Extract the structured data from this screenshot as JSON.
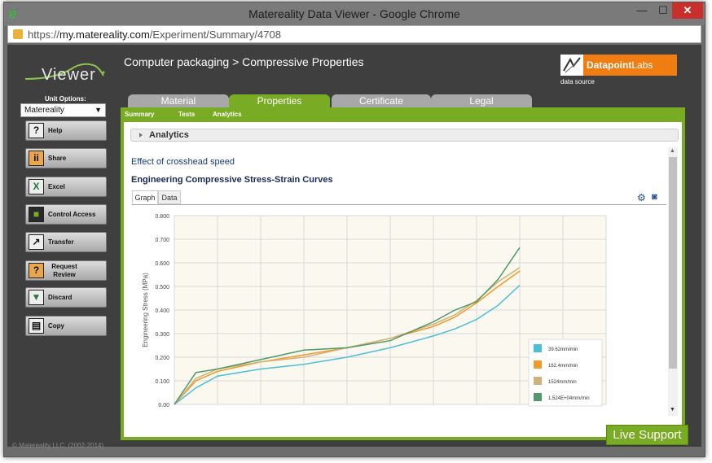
{
  "window": {
    "title": "Matereality Data Viewer - Google Chrome",
    "url_scheme": "https://",
    "url_host": "my.matereality.com",
    "url_path": "/Experiment/Summary/4708"
  },
  "header": {
    "logo_text": "Viewer",
    "breadcrumb": "Computer packaging > Compressive Properties",
    "provider_name_bold": "Datapoint",
    "provider_name_rest": "Labs",
    "provider_caption": "data source"
  },
  "sidebar": {
    "unit_label": "Unit Options:",
    "unit_value": "Matereality",
    "buttons": [
      {
        "label": "Help",
        "icon": "?"
      },
      {
        "label": "Share",
        "icon": "ii"
      },
      {
        "label": "Excel",
        "icon": "X"
      },
      {
        "label": "Control Access",
        "icon": "■"
      },
      {
        "label": "Transfer",
        "icon": "↗"
      },
      {
        "label": "Request Review",
        "icon": "?"
      },
      {
        "label": "Discard",
        "icon": "▼"
      },
      {
        "label": "Copy",
        "icon": "▤"
      }
    ],
    "copyright": "© Matereality LLC. (2002-2014)"
  },
  "tabs": [
    "Material",
    "Properties",
    "Certificate",
    "Legal"
  ],
  "subnav": [
    "Summary",
    "Tests",
    "Analytics"
  ],
  "main": {
    "section_label": "Analytics",
    "effect_title": "Effect of crosshead speed",
    "chart_heading": "Engineering Compressive Stress-Strain Curves",
    "graph_tabs": [
      "Graph",
      "Data"
    ]
  },
  "live_support": "Live Support",
  "colors": {
    "accent_green": "#7aab24",
    "brand_orange": "#ef7d12",
    "series": [
      "#4bbfd6",
      "#f09a2a",
      "#d2b07a",
      "#4e9a6a"
    ]
  },
  "chart_data": {
    "type": "line",
    "title": "",
    "xlabel": "",
    "ylabel": "Engineering Stress (MPa)",
    "ylim": [
      0,
      0.8
    ],
    "yticks": [
      "0.00",
      "0.100",
      "0.200",
      "0.300",
      "0.400",
      "0.500",
      "0.600",
      "0.700",
      "0.800"
    ],
    "xlim": [
      0,
      10
    ],
    "grid": true,
    "legend_position": "bottom-right",
    "series": [
      {
        "name": "39.62mm/min",
        "x": [
          0,
          0.5,
          1,
          2,
          3,
          4,
          5,
          6,
          6.5,
          7,
          7.5,
          8
        ],
        "y": [
          0,
          0.07,
          0.12,
          0.15,
          0.17,
          0.2,
          0.24,
          0.29,
          0.32,
          0.36,
          0.42,
          0.505
        ]
      },
      {
        "name": "162.4mm/min",
        "x": [
          0,
          0.5,
          1,
          2,
          3,
          4,
          5,
          6,
          6.5,
          7,
          7.5,
          8
        ],
        "y": [
          0,
          0.1,
          0.14,
          0.18,
          0.21,
          0.24,
          0.28,
          0.33,
          0.37,
          0.43,
          0.5,
          0.565
        ]
      },
      {
        "name": "1524mm/min",
        "x": [
          0,
          0.5,
          1,
          2,
          3,
          4,
          5,
          6,
          6.5,
          7,
          7.5,
          8
        ],
        "y": [
          0,
          0.11,
          0.15,
          0.18,
          0.2,
          0.24,
          0.28,
          0.34,
          0.38,
          0.44,
          0.52,
          0.58
        ]
      },
      {
        "name": "1.524E+04mm/min",
        "x": [
          0,
          0.5,
          1,
          2,
          3,
          4,
          5,
          6,
          6.5,
          7,
          7.5,
          8
        ],
        "y": [
          0,
          0.135,
          0.15,
          0.19,
          0.23,
          0.24,
          0.27,
          0.35,
          0.4,
          0.435,
          0.53,
          0.665
        ]
      }
    ]
  }
}
